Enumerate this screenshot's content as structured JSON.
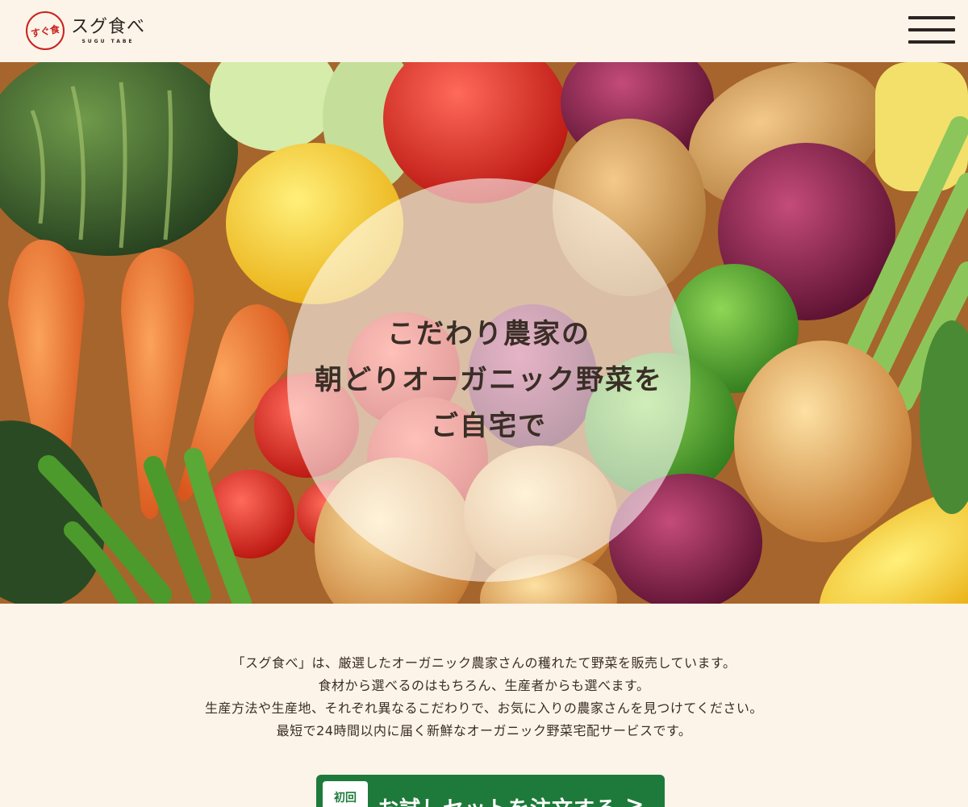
{
  "header": {
    "logo_mark": "すぐ食",
    "logo_name": "スグ食べ",
    "logo_sub": "SUGU TABE"
  },
  "hero": {
    "lines": [
      "こだわり農家の",
      "朝どりオーガニック野菜を",
      "ご自宅で"
    ]
  },
  "intro": {
    "lines": [
      "「スグ食べ」は、厳選したオーガニック農家さんの穫れたて野菜を販売しています。",
      "食材から選べるのはもちろん、生産者からも選べます。",
      "生産方法や生産地、それぞれ異なるこだわりで、お気に入りの農家さんを見つけてください。",
      "最短で24時間以内に届く新鮮なオーガニック野菜宅配サービスです。"
    ]
  },
  "cta": {
    "badge": "初回",
    "label": "お試しセットを注文する",
    "arrow": ">"
  },
  "colors": {
    "background": "#fdf4e9",
    "brand_red": "#c8231d",
    "cta_green": "#1e7a3a",
    "text": "#3a2e26"
  }
}
